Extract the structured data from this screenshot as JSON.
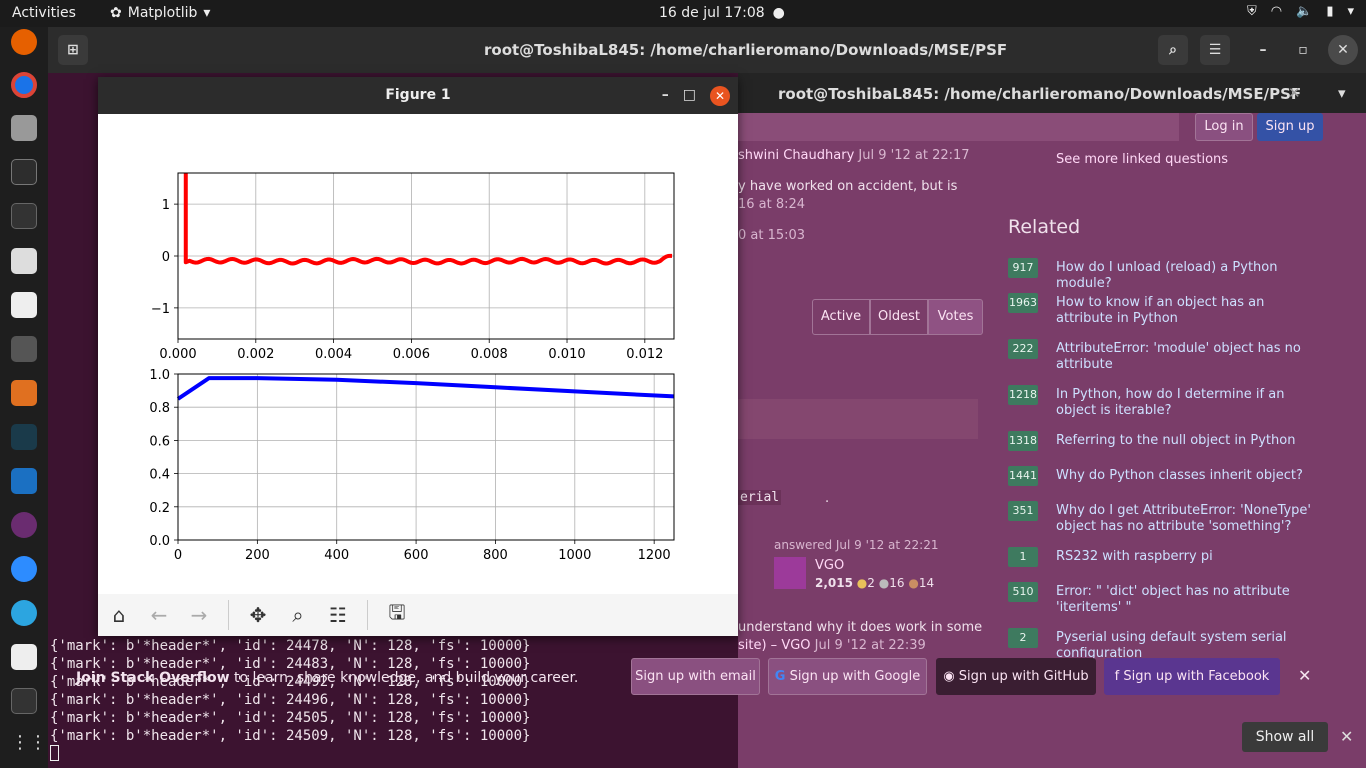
{
  "topbar": {
    "activities": "Activities",
    "app": "Matplotlib",
    "clock": "16 de jul  17:08"
  },
  "terminal": {
    "title": "root@ToshibaL845: /home/charlieromano/Downloads/MSE/PSF",
    "tab_title": "root@ToshibaL845: /home/charlieromano/Downloads/MSE/PSF",
    "lines_visible": [
      "{'mark': b'*header*', 'id': 24478, 'N': 128, 'fs': 10000}",
      "{'mark': b'*header*', 'id': 24483, 'N': 128, 'fs': 10000}",
      "{'mark': b'*header*', 'id': 24492, 'N': 128, 'fs': 10000}",
      "{'mark': b'*header*', 'id': 24496, 'N': 128, 'fs': 10000}",
      "{'mark': b'*header*', 'id': 24505, 'N': 128, 'fs': 10000}",
      "{'mark': b'*header*', 'id': 24509, 'N': 128, 'fs': 10000}"
    ]
  },
  "stackoverflow": {
    "login": "Log in",
    "signup": "Sign up",
    "see_more": "See more linked questions",
    "comment1_user": "shwini Chaudhary",
    "comment1_date": "Jul 9 '12 at 22:17",
    "comment2_text": "y have worked on accident, but is",
    "comment2_date": "16 at 8:24",
    "comment3_date": "0 at 15:03",
    "sort": [
      "Active",
      "Oldest",
      "Votes"
    ],
    "inline_code": "erial",
    "answered": "answered Jul 9 '12 at 22:21",
    "user": "VGO",
    "rep": "2,015",
    "badges": [
      "2",
      "16",
      "14"
    ],
    "comment4_text": "understand why it does work in some",
    "comment4_tail": "site) – VGO",
    "comment4_date": "Jul 9 '12 at 22:39",
    "related_title": "Related",
    "related": [
      {
        "votes": "917",
        "q": "How do I unload (reload) a Python module?"
      },
      {
        "votes": "1963",
        "q": "How to know if an object has an attribute in Python"
      },
      {
        "votes": "222",
        "q": "AttributeError: 'module' object has no attribute"
      },
      {
        "votes": "1218",
        "q": "In Python, how do I determine if an object is iterable?"
      },
      {
        "votes": "1318",
        "q": "Referring to the null object in Python"
      },
      {
        "votes": "1441",
        "q": "Why do Python classes inherit object?"
      },
      {
        "votes": "351",
        "q": "Why do I get AttributeError: 'NoneType' object has no attribute 'something'?"
      },
      {
        "votes": "1",
        "q": "RS232 with raspberry pi"
      },
      {
        "votes": "510",
        "q": "Error: \" 'dict' object has no attribute 'iteritems' \""
      },
      {
        "votes": "2",
        "q": "Pyserial using default system serial configuration"
      }
    ],
    "join_bold": "Join Stack Overflow",
    "join_text": " to learn, share knowledge, and build your career.",
    "signup_email": "Sign up with email",
    "signup_google": "Sign up with Google",
    "signup_github": "Sign up with GitHub",
    "signup_facebook": "Sign up with Facebook"
  },
  "figure": {
    "window_title": "Figure 1"
  },
  "chart_data": [
    {
      "type": "line",
      "xlim": [
        0,
        0.01275
      ],
      "ylim": [
        -1.6,
        1.6
      ],
      "xticks": [
        "0.000",
        "0.002",
        "0.004",
        "0.006",
        "0.008",
        "0.010",
        "0.012"
      ],
      "yticks": [
        "1",
        "0",
        "−1"
      ],
      "grid": true,
      "series": [
        {
          "color": "#ff0000",
          "desc": "spike then small oscillation around -0.1",
          "x": [
            0.0002,
            0.0002,
            0.0003,
            0.0006,
            0.0012,
            0.0024,
            0.0048,
            0.0072,
            0.0096,
            0.012,
            0.0127
          ],
          "y": [
            1.6,
            -0.12,
            -0.13,
            -0.1,
            -0.12,
            -0.09,
            -0.12,
            -0.09,
            -0.11,
            -0.08,
            -0.01
          ]
        }
      ]
    },
    {
      "type": "line",
      "xlim": [
        0,
        1250
      ],
      "ylim": [
        0,
        1.0
      ],
      "xticks": [
        "0",
        "200",
        "400",
        "600",
        "800",
        "1000",
        "1200"
      ],
      "yticks": [
        "1.0",
        "0.8",
        "0.6",
        "0.4",
        "0.2",
        "0.0"
      ],
      "grid": true,
      "series": [
        {
          "color": "#0000ff",
          "x": [
            0,
            78,
            200,
            400,
            600,
            800,
            1000,
            1250
          ],
          "y": [
            0.85,
            0.975,
            0.975,
            0.965,
            0.945,
            0.92,
            0.895,
            0.865
          ]
        }
      ]
    }
  ],
  "dock": {
    "show_all": "Show all"
  }
}
